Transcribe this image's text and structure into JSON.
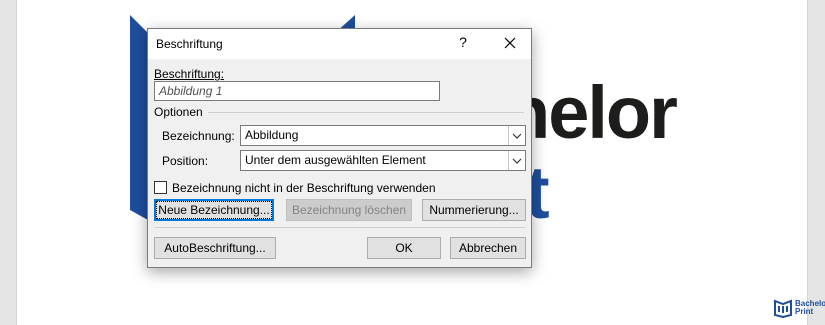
{
  "background": {
    "logo_text_1": "helor",
    "logo_text_2": "t",
    "watermark_line1": "Bachelor",
    "watermark_line2": "Print"
  },
  "dialog": {
    "title": "Beschriftung",
    "help_glyph": "?",
    "close_glyph": "✕",
    "caption_label": "Beschriftung:",
    "caption_value": "Abbildung 1",
    "options_group_label": "Optionen",
    "label_field_label": "Bezeichnung:",
    "label_field_value": "Abbildung",
    "position_field_label": "Position:",
    "position_field_value": "Unter dem ausgewählten Element",
    "exclude_label_checkbox": "Bezeichnung nicht in der Beschriftung verwenden",
    "exclude_label_checked": false,
    "new_label_button": "Neue Bezeichnung...",
    "delete_label_button": "Bezeichnung löschen",
    "numbering_button": "Nummerierung...",
    "autocaption_button": "AutoBeschriftung...",
    "ok_button": "OK",
    "cancel_button": "Abbrechen"
  },
  "colors": {
    "accent": "#0078d7",
    "dialog_bg": "#f0f0f0",
    "logo_blue": "#1e4e9c"
  }
}
